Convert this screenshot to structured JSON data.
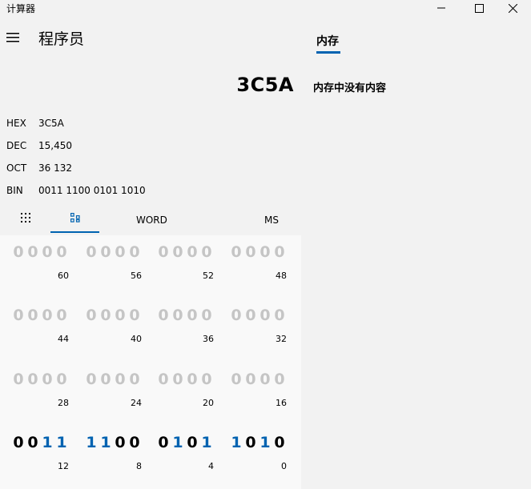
{
  "window": {
    "title": "计算器",
    "controls": [
      "minimize",
      "maximize",
      "close"
    ]
  },
  "header": {
    "mode_title": "程序员",
    "menu_icon": "hamburger-icon"
  },
  "memory": {
    "tab_label": "内存",
    "empty_text": "内存中没有内容"
  },
  "display": {
    "value": "3C5A"
  },
  "radix": [
    {
      "label": "HEX",
      "value": "3C5A"
    },
    {
      "label": "DEC",
      "value": "15,450"
    },
    {
      "label": "OCT",
      "value": "36 132"
    },
    {
      "label": "BIN",
      "value": "0011 1100 0101 1010"
    }
  ],
  "toolbar": {
    "keypad_icon": "keypad-icon",
    "bit_toggle_icon": "bit-toggle-icon",
    "word_label": "WORD",
    "ms_label": "MS"
  },
  "bit_panel": {
    "rows": [
      {
        "nibbles": [
          {
            "bits": [
              "0",
              "0",
              "0",
              "0"
            ],
            "pos": "60"
          },
          {
            "bits": [
              "0",
              "0",
              "0",
              "0"
            ],
            "pos": "56"
          },
          {
            "bits": [
              "0",
              "0",
              "0",
              "0"
            ],
            "pos": "52"
          },
          {
            "bits": [
              "0",
              "0",
              "0",
              "0"
            ],
            "pos": "48"
          }
        ]
      },
      {
        "nibbles": [
          {
            "bits": [
              "0",
              "0",
              "0",
              "0"
            ],
            "pos": "44"
          },
          {
            "bits": [
              "0",
              "0",
              "0",
              "0"
            ],
            "pos": "40"
          },
          {
            "bits": [
              "0",
              "0",
              "0",
              "0"
            ],
            "pos": "36"
          },
          {
            "bits": [
              "0",
              "0",
              "0",
              "0"
            ],
            "pos": "32"
          }
        ]
      },
      {
        "nibbles": [
          {
            "bits": [
              "0",
              "0",
              "0",
              "0"
            ],
            "pos": "28"
          },
          {
            "bits": [
              "0",
              "0",
              "0",
              "0"
            ],
            "pos": "24"
          },
          {
            "bits": [
              "0",
              "0",
              "0",
              "0"
            ],
            "pos": "20"
          },
          {
            "bits": [
              "0",
              "0",
              "0",
              "0"
            ],
            "pos": "16"
          }
        ]
      },
      {
        "active": true,
        "nibbles": [
          {
            "bits": [
              "0",
              "0",
              "1",
              "1"
            ],
            "pos": "12"
          },
          {
            "bits": [
              "1",
              "1",
              "0",
              "0"
            ],
            "pos": "8"
          },
          {
            "bits": [
              "0",
              "1",
              "0",
              "1"
            ],
            "pos": "4"
          },
          {
            "bits": [
              "1",
              "0",
              "1",
              "0"
            ],
            "pos": "0"
          }
        ]
      }
    ]
  },
  "colors": {
    "accent": "#0063b1",
    "inactive_bit": "#c5c5c5",
    "background": "#f2f2f2",
    "panel": "#f9f9f9"
  }
}
